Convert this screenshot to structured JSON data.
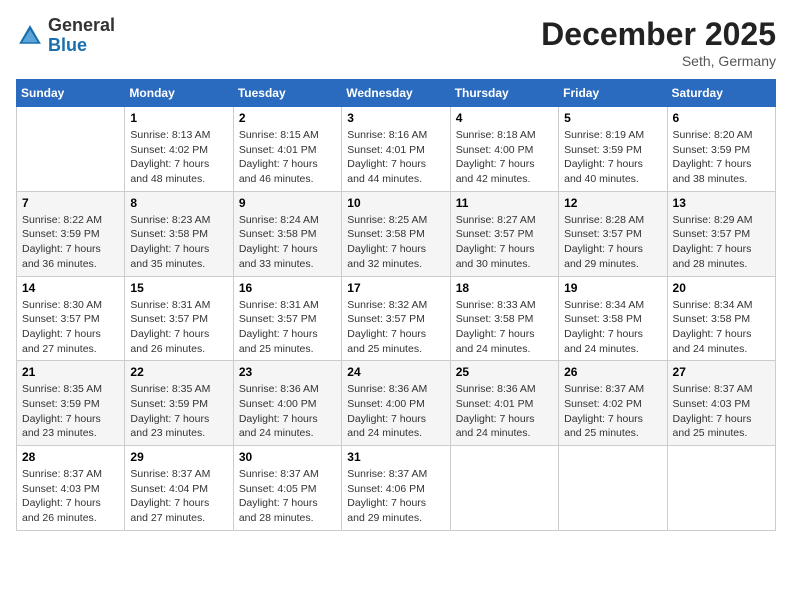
{
  "header": {
    "logo_line1": "General",
    "logo_line2": "Blue",
    "month_year": "December 2025",
    "location": "Seth, Germany"
  },
  "days_of_week": [
    "Sunday",
    "Monday",
    "Tuesday",
    "Wednesday",
    "Thursday",
    "Friday",
    "Saturday"
  ],
  "weeks": [
    [
      null,
      {
        "day": "1",
        "sunrise": "8:13 AM",
        "sunset": "4:02 PM",
        "daylight": "7 hours and 48 minutes."
      },
      {
        "day": "2",
        "sunrise": "8:15 AM",
        "sunset": "4:01 PM",
        "daylight": "7 hours and 46 minutes."
      },
      {
        "day": "3",
        "sunrise": "8:16 AM",
        "sunset": "4:01 PM",
        "daylight": "7 hours and 44 minutes."
      },
      {
        "day": "4",
        "sunrise": "8:18 AM",
        "sunset": "4:00 PM",
        "daylight": "7 hours and 42 minutes."
      },
      {
        "day": "5",
        "sunrise": "8:19 AM",
        "sunset": "3:59 PM",
        "daylight": "7 hours and 40 minutes."
      },
      {
        "day": "6",
        "sunrise": "8:20 AM",
        "sunset": "3:59 PM",
        "daylight": "7 hours and 38 minutes."
      }
    ],
    [
      {
        "day": "7",
        "sunrise": "8:22 AM",
        "sunset": "3:59 PM",
        "daylight": "7 hours and 36 minutes."
      },
      {
        "day": "8",
        "sunrise": "8:23 AM",
        "sunset": "3:58 PM",
        "daylight": "7 hours and 35 minutes."
      },
      {
        "day": "9",
        "sunrise": "8:24 AM",
        "sunset": "3:58 PM",
        "daylight": "7 hours and 33 minutes."
      },
      {
        "day": "10",
        "sunrise": "8:25 AM",
        "sunset": "3:58 PM",
        "daylight": "7 hours and 32 minutes."
      },
      {
        "day": "11",
        "sunrise": "8:27 AM",
        "sunset": "3:57 PM",
        "daylight": "7 hours and 30 minutes."
      },
      {
        "day": "12",
        "sunrise": "8:28 AM",
        "sunset": "3:57 PM",
        "daylight": "7 hours and 29 minutes."
      },
      {
        "day": "13",
        "sunrise": "8:29 AM",
        "sunset": "3:57 PM",
        "daylight": "7 hours and 28 minutes."
      }
    ],
    [
      {
        "day": "14",
        "sunrise": "8:30 AM",
        "sunset": "3:57 PM",
        "daylight": "7 hours and 27 minutes."
      },
      {
        "day": "15",
        "sunrise": "8:31 AM",
        "sunset": "3:57 PM",
        "daylight": "7 hours and 26 minutes."
      },
      {
        "day": "16",
        "sunrise": "8:31 AM",
        "sunset": "3:57 PM",
        "daylight": "7 hours and 25 minutes."
      },
      {
        "day": "17",
        "sunrise": "8:32 AM",
        "sunset": "3:57 PM",
        "daylight": "7 hours and 25 minutes."
      },
      {
        "day": "18",
        "sunrise": "8:33 AM",
        "sunset": "3:58 PM",
        "daylight": "7 hours and 24 minutes."
      },
      {
        "day": "19",
        "sunrise": "8:34 AM",
        "sunset": "3:58 PM",
        "daylight": "7 hours and 24 minutes."
      },
      {
        "day": "20",
        "sunrise": "8:34 AM",
        "sunset": "3:58 PM",
        "daylight": "7 hours and 24 minutes."
      }
    ],
    [
      {
        "day": "21",
        "sunrise": "8:35 AM",
        "sunset": "3:59 PM",
        "daylight": "7 hours and 23 minutes."
      },
      {
        "day": "22",
        "sunrise": "8:35 AM",
        "sunset": "3:59 PM",
        "daylight": "7 hours and 23 minutes."
      },
      {
        "day": "23",
        "sunrise": "8:36 AM",
        "sunset": "4:00 PM",
        "daylight": "7 hours and 24 minutes."
      },
      {
        "day": "24",
        "sunrise": "8:36 AM",
        "sunset": "4:00 PM",
        "daylight": "7 hours and 24 minutes."
      },
      {
        "day": "25",
        "sunrise": "8:36 AM",
        "sunset": "4:01 PM",
        "daylight": "7 hours and 24 minutes."
      },
      {
        "day": "26",
        "sunrise": "8:37 AM",
        "sunset": "4:02 PM",
        "daylight": "7 hours and 25 minutes."
      },
      {
        "day": "27",
        "sunrise": "8:37 AM",
        "sunset": "4:03 PM",
        "daylight": "7 hours and 25 minutes."
      }
    ],
    [
      {
        "day": "28",
        "sunrise": "8:37 AM",
        "sunset": "4:03 PM",
        "daylight": "7 hours and 26 minutes."
      },
      {
        "day": "29",
        "sunrise": "8:37 AM",
        "sunset": "4:04 PM",
        "daylight": "7 hours and 27 minutes."
      },
      {
        "day": "30",
        "sunrise": "8:37 AM",
        "sunset": "4:05 PM",
        "daylight": "7 hours and 28 minutes."
      },
      {
        "day": "31",
        "sunrise": "8:37 AM",
        "sunset": "4:06 PM",
        "daylight": "7 hours and 29 minutes."
      },
      null,
      null,
      null
    ]
  ]
}
